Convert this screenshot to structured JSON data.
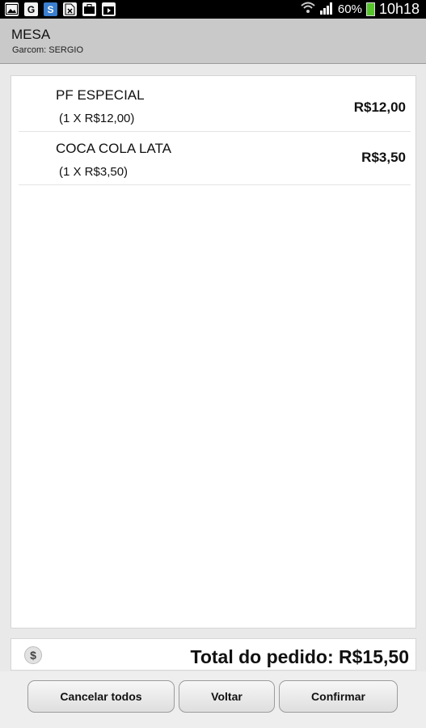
{
  "status_bar": {
    "icons": [
      "image-icon",
      "g-icon",
      "s-app-icon",
      "document-x-icon",
      "briefcase-icon",
      "play-bag-icon"
    ],
    "g_letter": "G",
    "s_letter": "S",
    "battery": "60%",
    "time": "10h18"
  },
  "header": {
    "title": "MESA",
    "subtitle": "Garcom: SERGIO"
  },
  "items": [
    {
      "name": "PF ESPECIAL",
      "qty": "(1 X R$12,00)",
      "price": "R$12,00"
    },
    {
      "name": "COCA COLA LATA",
      "qty": "(1 X R$3,50)",
      "price": "R$3,50"
    }
  ],
  "total": {
    "icon": "dollar-icon",
    "symbol": "$",
    "label": "Total do pedido:",
    "value": "R$15,50"
  },
  "buttons": {
    "cancel": "Cancelar todos",
    "back": "Voltar",
    "confirm": "Confirmar"
  },
  "colors": {
    "battery": "#55c52b",
    "header_bg": "#c9c9c9"
  }
}
